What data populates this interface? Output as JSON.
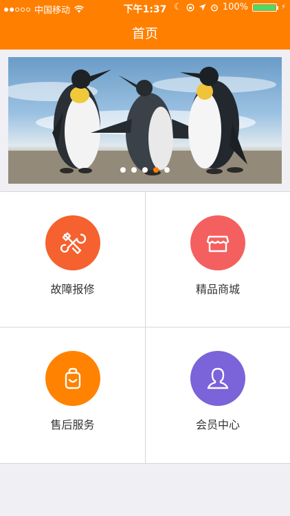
{
  "status_bar": {
    "carrier": "中国移动",
    "time": "下午1:37",
    "battery": "100%"
  },
  "nav": {
    "title": "首页"
  },
  "banner": {
    "page_count": 5,
    "active_index": 3
  },
  "menu": [
    {
      "label": "故障报修",
      "icon": "wrench-tools-icon",
      "color": "#f5612f"
    },
    {
      "label": "精品商城",
      "icon": "shop-icon",
      "color": "#f4605f"
    },
    {
      "label": "售后服务",
      "icon": "shopping-bag-icon",
      "color": "#ff8200"
    },
    {
      "label": "会员中心",
      "icon": "user-icon",
      "color": "#7b63d9"
    }
  ],
  "colors": {
    "accent": "#ff7f00",
    "battery": "#4cd964"
  }
}
